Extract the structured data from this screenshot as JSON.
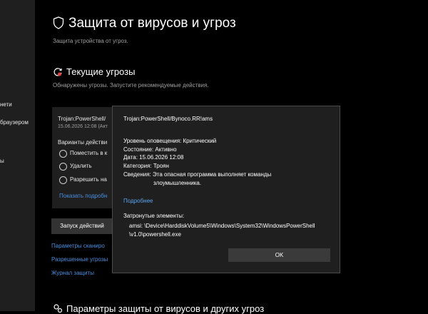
{
  "nav": {
    "items": [
      "нети",
      "браузером",
      "ы"
    ]
  },
  "page": {
    "title": "Защита от вирусов и угроз",
    "subtitle": "Защита устройства от угроз."
  },
  "current_threats": {
    "title": "Текущие угрозы",
    "subtitle": "Обнаружены угрозы. Запустите рекомендуемые действия.",
    "card": {
      "threat_name": "Trojan:PowerShell/",
      "date": "15.06.2026 12:08 (Акт",
      "options_label": "Варианты действи",
      "options": [
        "Поместить в к",
        "Удалить",
        "Разрешить на"
      ],
      "details_link": "Показать подробн"
    },
    "start_button": "Запуск действий",
    "links": [
      "Параметры сканиро",
      "Разрешенные угрозы",
      "Журнал защиты"
    ]
  },
  "section2": {
    "title": "Параметры защиты от вирусов и других угроз"
  },
  "dialog": {
    "threat_name": "Trojan:PowerShell/Bynoco.RR!ams",
    "alert_level": "Уровень оповещения: Критический",
    "status": "Состояние: Активно",
    "date": "Дата: 15.06.2026 12:08",
    "category": "Категория: Троян",
    "details_line1": "Сведения: Эта опасная программа выполняет команды",
    "details_line2": "злоумышленника.",
    "more_link": "Подробнее",
    "affected_label": "Затронутые элементы:",
    "affected_line1": "amsi: \\Device\\HarddiskVolume5\\Windows\\System32\\WindowsPowerShell",
    "affected_line2": "\\v1.0\\powershell.exe",
    "ok_label": "OK"
  },
  "colors": {
    "background": "#000000",
    "panel": "#1f1f1f",
    "link": "#4a8fe0",
    "threat_icon": "#e04040",
    "button": "#3a3a3a"
  },
  "icons": {
    "title": "shield-icon",
    "threats": "threat-refresh-icon",
    "settings": "gear-icon"
  }
}
